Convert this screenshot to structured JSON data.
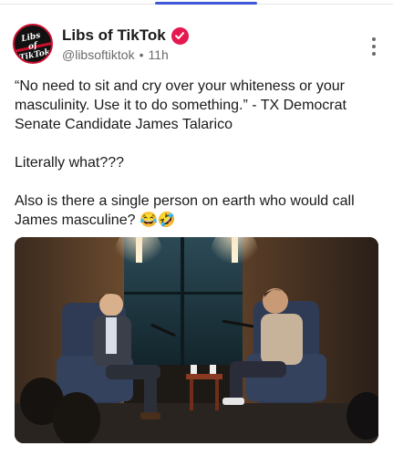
{
  "post": {
    "display_name": "Libs of TikTok",
    "handle": "@libsoftiktok",
    "separator": "•",
    "time": "11h",
    "avatar_text": "Libs of TikTok",
    "paragraphs": [
      "“No need to sit and cry over your whiteness or your masculinity. Use it to do something.” - TX Democrat Senate Candidate James Talarico",
      "Literally what???",
      "Also is there a single person on earth who would call James masculine? 😂🤣"
    ]
  },
  "icons": {
    "verified": "verified-badge-icon",
    "more": "more-vertical-icon"
  },
  "colors": {
    "verified": "#e5194f",
    "tab_indicator": "#3d57d6",
    "handle": "#6b6b6b"
  }
}
